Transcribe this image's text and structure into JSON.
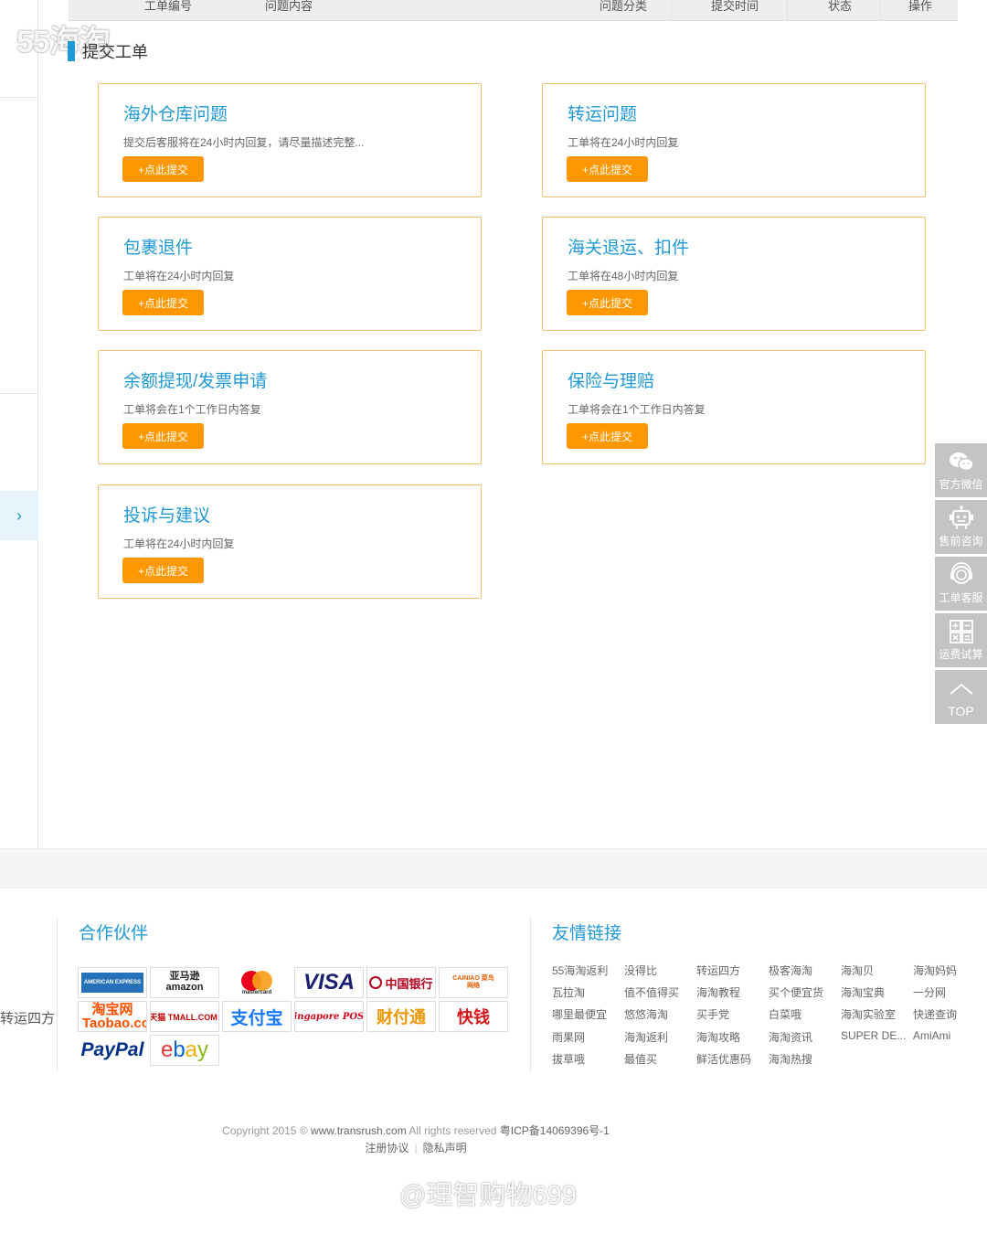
{
  "table_header": {
    "cols": [
      "工单编号",
      "问题内容",
      "问题分类",
      "提交时间",
      "状态",
      "操作"
    ]
  },
  "watermark_top": "55海淘",
  "section": {
    "title": "提交工单"
  },
  "cards": [
    {
      "title": "海外仓库问题",
      "desc": "提交后客服将在24小时内回复，请尽量描述完整...",
      "button": "+点此提交"
    },
    {
      "title": "转运问题",
      "desc": "工单将在24小时内回复",
      "button": "+点此提交"
    },
    {
      "title": "包裹退件",
      "desc": "工单将在24小时内回复",
      "button": "+点此提交"
    },
    {
      "title": "海关退运、扣件",
      "desc": "工单将在48小时内回复",
      "button": "+点此提交"
    },
    {
      "title": "余额提现/发票申请",
      "desc": "工单将会在1个工作日内答复",
      "button": "+点此提交"
    },
    {
      "title": "保险与理赔",
      "desc": "工单将会在1个工作日内答复",
      "button": "+点此提交"
    },
    {
      "title": "投诉与建议",
      "desc": "工单将在24小时内回复",
      "button": "+点此提交"
    }
  ],
  "float_panel": {
    "items": [
      {
        "label": "官方微信",
        "icon": "wechat-icon"
      },
      {
        "label": "售前咨询",
        "icon": "robot-icon"
      },
      {
        "label": "工单客服",
        "icon": "headset-icon"
      },
      {
        "label": "运费试算",
        "icon": "calculator-icon"
      },
      {
        "label": "TOP",
        "icon": "arrow-up-icon"
      }
    ]
  },
  "side_toggle": "›",
  "footer": {
    "cut_text": "转运四方",
    "partners_title": "合作伙伴",
    "links_title": "友情链接",
    "partners": [
      {
        "label": "AMERICAN EXPRESS",
        "color": "#2671b9"
      },
      {
        "label": "亚马逊 amazon",
        "color": "#222222"
      },
      {
        "label": "mastercard",
        "color": "#eb001b"
      },
      {
        "label": "VISA",
        "color": "#1a1f71"
      },
      {
        "label": "中国银行",
        "color": "#b4001e"
      },
      {
        "label": "CAINIAO 菜鸟网络",
        "color": "#e65c00"
      },
      {
        "label": "淘宝网 Taobao.com",
        "color": "#ff5000"
      },
      {
        "label": "天猫 TMALL.COM",
        "color": "#c40000"
      },
      {
        "label": "支付宝",
        "color": "#1677ff"
      },
      {
        "label": "Singapore POST",
        "color": "#d0021b"
      },
      {
        "label": "财付通",
        "color": "#f29600"
      },
      {
        "label": "快钱",
        "color": "#d6161b"
      },
      {
        "label": "PayPal",
        "color": "#003087"
      },
      {
        "label": "ebay",
        "color": "#e53238"
      }
    ],
    "links": [
      [
        "55海淘返利",
        "没得比",
        "转运四方",
        "极客海淘",
        "海淘贝",
        "海淘妈妈"
      ],
      [
        "瓦拉淘",
        "值不值得买",
        "海淘教程",
        "买个便宜货",
        "海淘宝典",
        "一分网"
      ],
      [
        "哪里最便宜",
        "悠悠海淘",
        "买手党",
        "白菜哦",
        "海淘实验室",
        "快递查询"
      ],
      [
        "雨果网",
        "海淘返利",
        "海淘攻略",
        "海淘资讯",
        "SUPER DE...",
        "AmiAmi"
      ],
      [
        "拔草哦",
        "最值买",
        "鲜活优惠码",
        "海淘热搜"
      ]
    ],
    "copyright_pre": "Copyright 2015 © ",
    "copyright_site": "www.transrush.com",
    "copyright_mid": " All rights reserved ",
    "copyright_icp": "粤ICP备14069396号-1",
    "bottom_links": [
      "注册协议",
      "隐私声明"
    ]
  },
  "watermark_bottom": "@理智购物699",
  "colors": {
    "accent": "#1f9ad6",
    "button": "#ff9800",
    "card_border": "#f5c06a",
    "float_bg": "#c4c4c4"
  }
}
